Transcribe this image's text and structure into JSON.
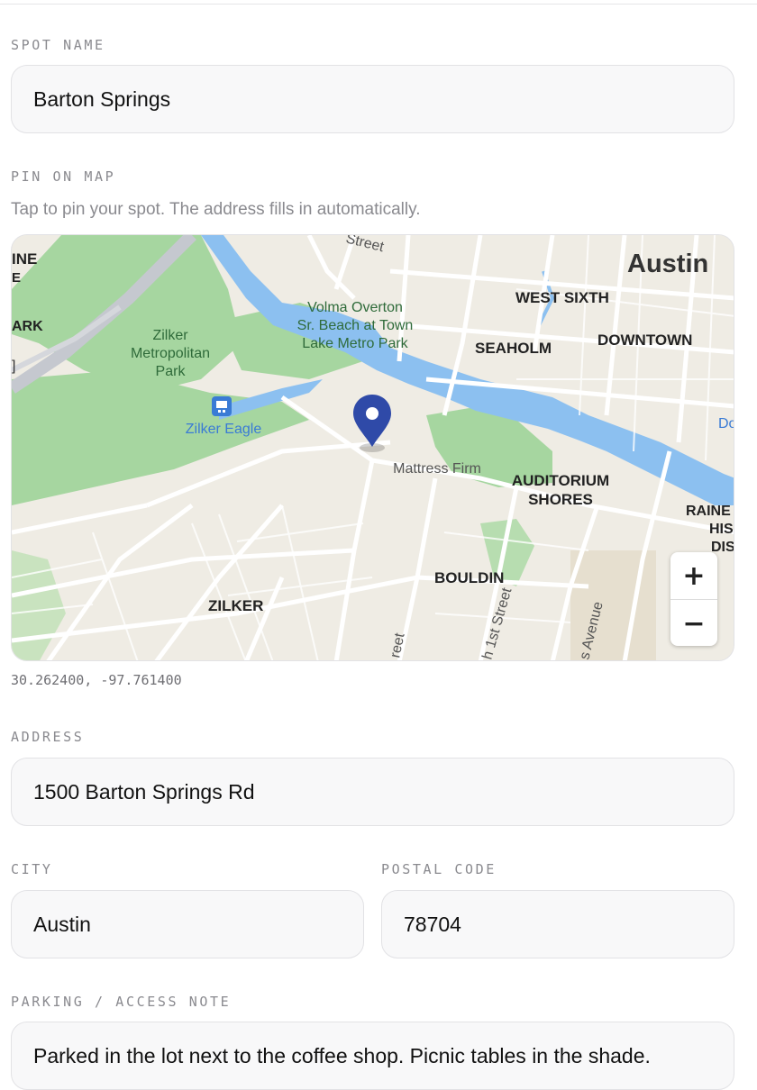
{
  "form": {
    "spot_name_label": "SPOT NAME",
    "spot_name_value": "Barton Springs",
    "pin_label": "PIN ON MAP",
    "pin_help": "Tap to pin your spot. The address fills in automatically.",
    "coordinates": "30.262400, -97.761400",
    "address_label": "ADDRESS",
    "address_value": "1500 Barton Springs Rd",
    "city_label": "CITY",
    "city_value": "Austin",
    "postal_label": "POSTAL CODE",
    "postal_value": "78704",
    "note_label": "PARKING / ACCESS NOTE",
    "note_value": "Parked in the lot next to the coffee shop. Picnic tables in the shade."
  },
  "map": {
    "zoom_in": "+",
    "zoom_out": "−",
    "labels": {
      "austin": "Austin",
      "west_sixth": "WEST SIXTH",
      "downtown": "DOWNTOWN",
      "seaholm": "SEAHOLM",
      "volma_1": "Volma Overton",
      "volma_2": "Sr. Beach at Town",
      "volma_3": "Lake Metro Park",
      "zilker_park_1": "Zilker",
      "zilker_park_2": "Metropolitan",
      "zilker_park_3": "Park",
      "zilker_eagle": "Zilker Eagle",
      "mattress_firm": "Mattress Firm",
      "auditorium_1": "AUDITORIUM",
      "auditorium_2": "SHORES",
      "bouldin": "BOULDIN",
      "zilker": "ZILKER",
      "rainey_1": "RAINE",
      "rainey_2": "HIS",
      "rainey_3": "DIS",
      "edge_ine": "INE",
      "edge_e": "E",
      "edge_ark": "ARK",
      "edge_bracket": "]",
      "edge_do": "Do",
      "street_top": "Street",
      "street_bottom": "reet",
      "first_street": "h 1st Street",
      "s_avenue": "s Avenue"
    },
    "colors": {
      "water": "#8cc0f0",
      "park": "#a6d6a0",
      "land": "#efece4",
      "pin": "#2f4aa8"
    }
  }
}
